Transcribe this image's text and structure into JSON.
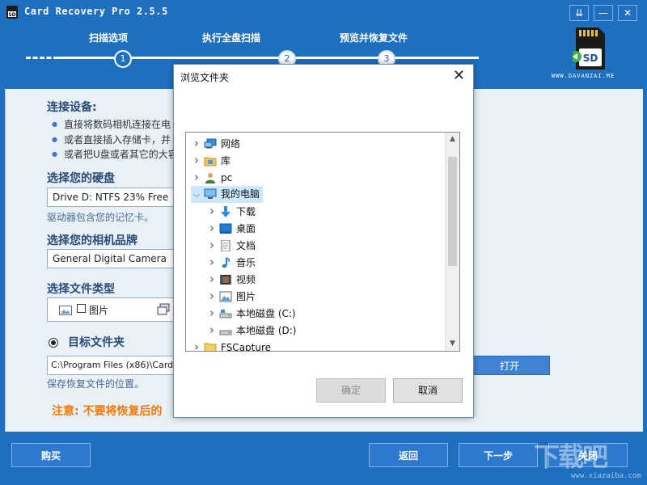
{
  "app": {
    "title": "Card Recovery Pro 2.5.5",
    "window_controls": [
      "⇊",
      "—",
      "✕"
    ],
    "brand": "WWW.DAVANZAI.ME",
    "sd_label": "SD"
  },
  "steps": [
    {
      "label": "扫描选项",
      "number": "1",
      "active": true
    },
    {
      "label": "执行全盘扫描",
      "number": "2",
      "active": false
    },
    {
      "label": "预览并恢复文件",
      "number": "3",
      "active": false
    }
  ],
  "connect": {
    "title": "连接设备:",
    "bullets": [
      "直接将数码相机连接在电",
      "或者直接插入存储卡，并",
      "或者把U盘或者其它的大容"
    ]
  },
  "drive": {
    "title": "选择您的硬盘",
    "value": "Drive D: NTFS 23% Free",
    "hint": "驱动器包含您的记忆卡。"
  },
  "camera": {
    "title": "选择您的相机品牌",
    "value": "General Digital Camera"
  },
  "filetype": {
    "title": "选择文件类型",
    "option_label": "图片"
  },
  "target": {
    "title": "目标文件夹",
    "path": "C:\\Program Files (x86)\\Card",
    "hint": "保存恢复文件的位置。",
    "open_label": "打开"
  },
  "warning": "注意: 不要将恢复后的",
  "footer": {
    "buy": "购买",
    "back": "返回",
    "next": "下一步",
    "close": "关闭"
  },
  "watermark": {
    "main": "下载吧",
    "sub": "www.xiazaiba.com"
  },
  "dialog": {
    "title": "浏览文件夹",
    "tree": [
      {
        "label": "网络",
        "icon": "network-icon",
        "level": 0,
        "expanded": false
      },
      {
        "label": "库",
        "icon": "library-icon",
        "level": 0,
        "expanded": false
      },
      {
        "label": "pc",
        "icon": "user-icon",
        "level": 0,
        "expanded": false
      },
      {
        "label": "我的电脑",
        "icon": "computer-icon",
        "level": 0,
        "expanded": true,
        "selected": true
      },
      {
        "label": "下载",
        "icon": "download-icon",
        "level": 1,
        "expanded": false
      },
      {
        "label": "桌面",
        "icon": "desktop-icon",
        "level": 1,
        "expanded": false
      },
      {
        "label": "文档",
        "icon": "document-icon",
        "level": 1,
        "expanded": false
      },
      {
        "label": "音乐",
        "icon": "music-icon",
        "level": 1,
        "expanded": false
      },
      {
        "label": "视频",
        "icon": "video-icon",
        "level": 1,
        "expanded": false
      },
      {
        "label": "图片",
        "icon": "picture-icon",
        "level": 1,
        "expanded": false
      },
      {
        "label": "本地磁盘 (C:)",
        "icon": "drive-c-icon",
        "level": 1,
        "expanded": false
      },
      {
        "label": "本地磁盘 (D:)",
        "icon": "drive-icon",
        "level": 1,
        "expanded": false
      },
      {
        "label": "FSCapture",
        "icon": "folder-icon",
        "level": 0,
        "expanded": false
      }
    ],
    "ok_label": "确定",
    "cancel_label": "取消"
  },
  "colors": {
    "accent": "#1f6fc0",
    "warning": "#f07a10",
    "selection": "#cce8ff"
  }
}
